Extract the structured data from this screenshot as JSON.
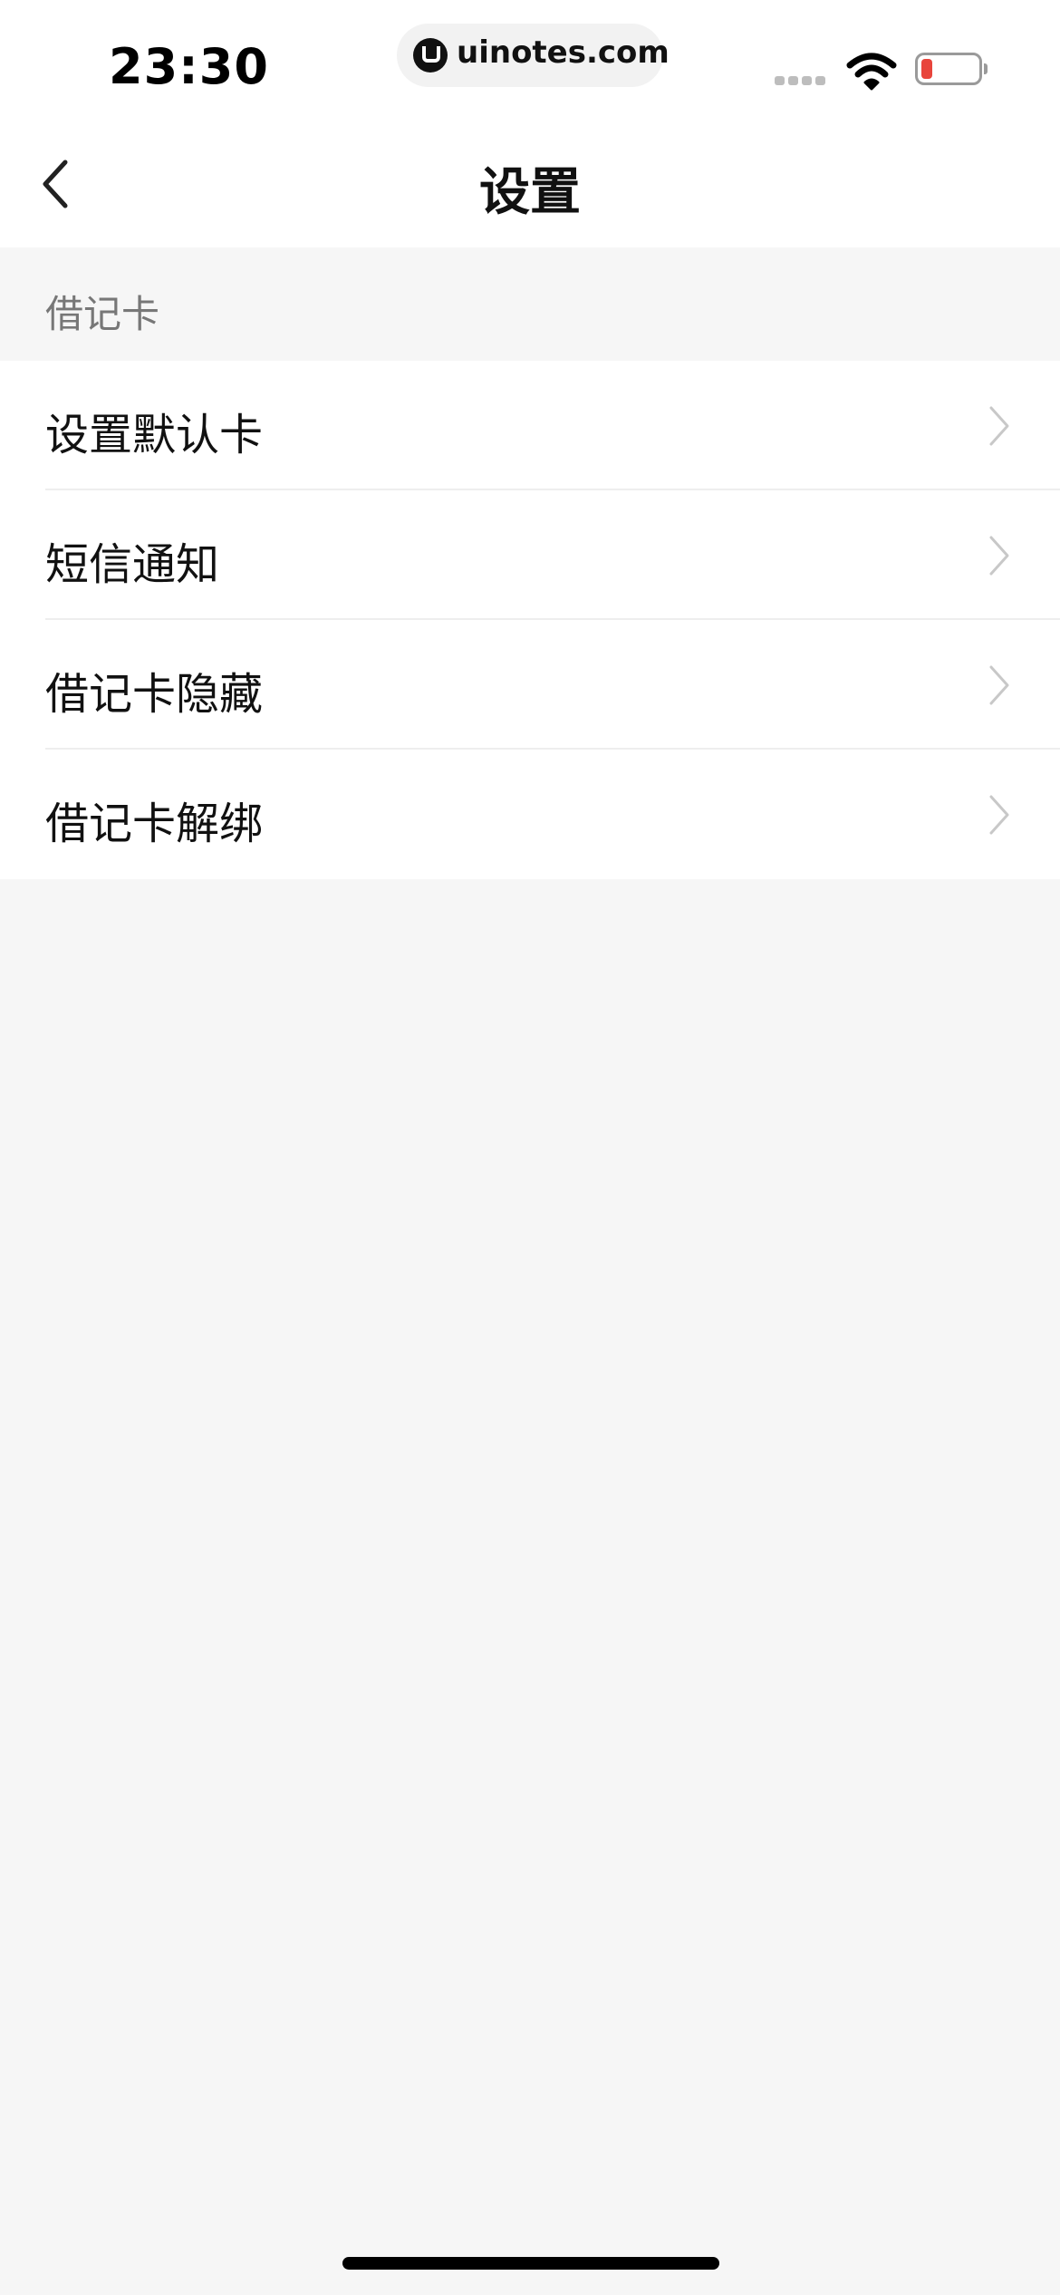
{
  "status_bar": {
    "time": "23:30",
    "url": "uinotes.com",
    "battery_color": "#e8453c"
  },
  "nav": {
    "title": "设置",
    "back_icon": "chevron-left-icon"
  },
  "section": {
    "header": "借记卡"
  },
  "menu": {
    "items": [
      {
        "label": "设置默认卡",
        "icon": "chevron-right-icon"
      },
      {
        "label": "短信通知",
        "icon": "chevron-right-icon"
      },
      {
        "label": "借记卡隐藏",
        "icon": "chevron-right-icon"
      },
      {
        "label": "借记卡解绑",
        "icon": "chevron-right-icon"
      }
    ]
  }
}
